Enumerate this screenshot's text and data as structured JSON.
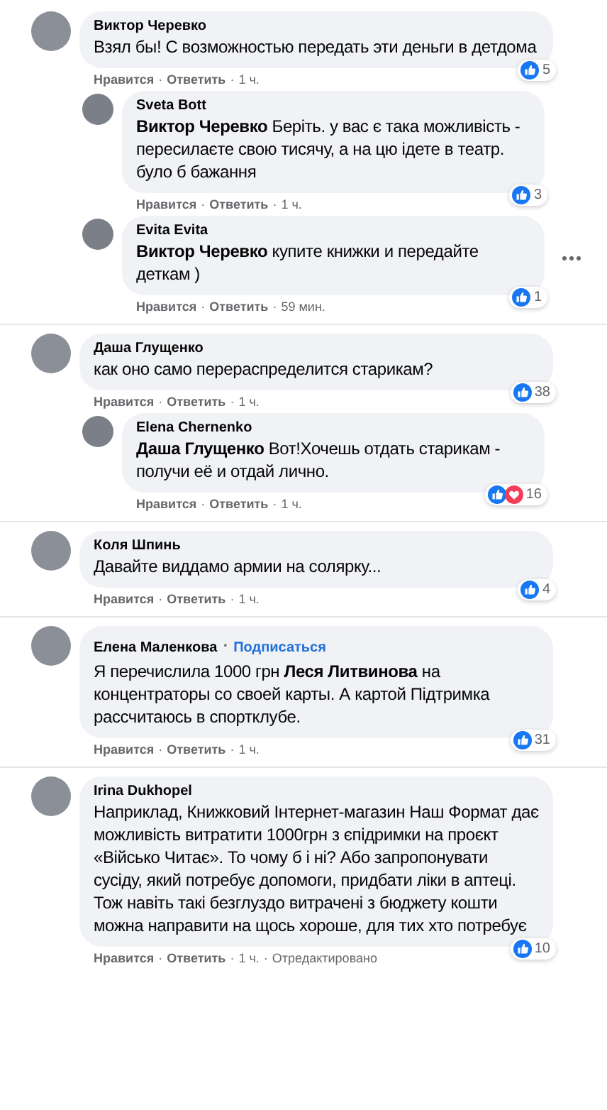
{
  "separator": "·",
  "comments": [
    {
      "author": "Виктор Черевко",
      "text": "Взял бы! С возможностью передать эти деньги в детдома",
      "love": false,
      "count": "5",
      "like": "Нравится",
      "reply": "Ответить",
      "time": "1 ч.",
      "more": false,
      "children": [
        {
          "author": "Sveta Bott",
          "text": "**Виктор Черевко** Беріть. у вас є така можливість - пересилаєте свою тисячу, а на цю ідете в театр. було б бажання",
          "love": false,
          "count": "3",
          "like": "Нравится",
          "reply": "Ответить",
          "time": "1 ч.",
          "more": false
        },
        {
          "author": "Evita Evita",
          "text": "**Виктор Черевко** купите книжки и передайте деткам )",
          "love": false,
          "count": "1",
          "like": "Нравится",
          "reply": "Ответить",
          "time": "59 мин.",
          "more": true
        }
      ]
    },
    {
      "author": "Даша Глущенко",
      "text": "как оно само перераспределится старикам?",
      "love": false,
      "count": "38",
      "like": "Нравится",
      "reply": "Ответить",
      "time": "1 ч.",
      "more": false,
      "children": [
        {
          "author": "Elena Chernenko",
          "text": "**Даша Глущенко** Вот!Хочешь отдать старикам - получи её и отдай лично.",
          "love": true,
          "count": "16",
          "like": "Нравится",
          "reply": "Ответить",
          "time": "1 ч.",
          "more": false
        }
      ]
    },
    {
      "author": "Коля Шпинь",
      "text": "Давайте виддамо армии на солярку...",
      "love": false,
      "count": "4",
      "like": "Нравится",
      "reply": "Ответить",
      "time": "1 ч.",
      "more": false
    },
    {
      "author": "Елена Маленкова",
      "follow": "Подписаться",
      "text": "Я перечислила 1000 грн **Леся Литвинова** на концентраторы со своей карты. А картой Підтримка рассчитаюсь в спортклубе.",
      "love": false,
      "count": "31",
      "like": "Нравится",
      "reply": "Ответить",
      "time": "1 ч.",
      "more": false
    },
    {
      "author": "Irina Dukhopel",
      "text": "Наприклад, Книжковий Інтернет-магазин Наш Формат дає можливість витратити 1000грн з єпідримки на проєкт «Військо Читає». То чому б і ні? Або запропонувати сусіду, який потребує допомоги, придбати ліки в аптеці. Тож навіть такі безглуздо витрачені з бюджету кошти можна направити на щось хороше, для тих хто потребує",
      "love": false,
      "count": "10",
      "like": "Нравится",
      "reply": "Ответить",
      "time": "1 ч.",
      "edited": "Отредактировано",
      "more": false
    }
  ]
}
